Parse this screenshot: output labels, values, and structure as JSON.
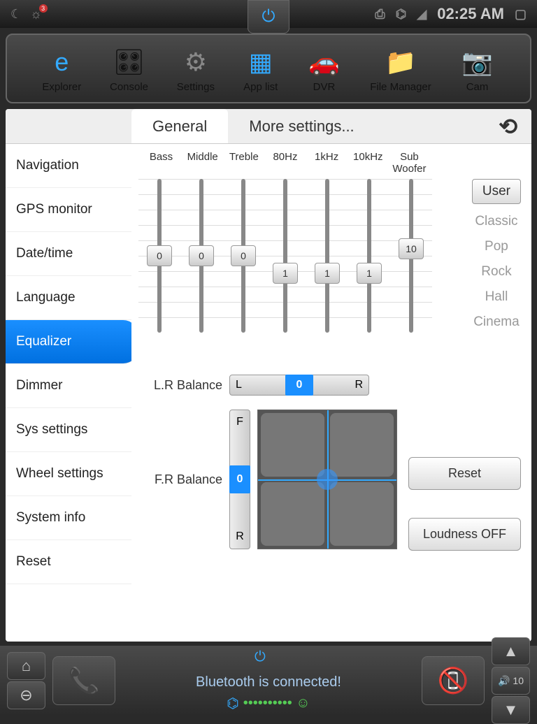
{
  "status": {
    "time": "02:25 AM",
    "badge": "3"
  },
  "dock": [
    {
      "label": "Explorer"
    },
    {
      "label": "Console"
    },
    {
      "label": "Settings"
    },
    {
      "label": "App list"
    },
    {
      "label": "DVR"
    },
    {
      "label": "File Manager"
    },
    {
      "label": "Cam"
    }
  ],
  "tabs": {
    "general": "General",
    "more": "More settings..."
  },
  "sidebar": [
    "Navigation",
    "GPS monitor",
    "Date/time",
    "Language",
    "Equalizer",
    "Dimmer",
    "Sys settings",
    "Wheel settings",
    "System info",
    "Reset"
  ],
  "eq": {
    "bands": [
      "Bass",
      "Middle",
      "Treble",
      "80Hz",
      "1kHz",
      "10kHz",
      "Sub Woofer"
    ],
    "values": [
      "0",
      "0",
      "0",
      "1",
      "1",
      "1",
      "10"
    ],
    "positions": [
      50,
      50,
      50,
      60,
      60,
      60,
      42
    ]
  },
  "presets": [
    "User",
    "Classic",
    "Pop",
    "Rock",
    "Hall",
    "Cinema"
  ],
  "balance": {
    "lr_label": "L.R Balance",
    "lr_l": "L",
    "lr_r": "R",
    "lr_value": "0",
    "fr_label": "F.R Balance",
    "fr_f": "F",
    "fr_r": "R",
    "fr_value": "0"
  },
  "actions": {
    "reset": "Reset",
    "loudness": "Loudness OFF"
  },
  "bottom": {
    "bt_text": "Bluetooth is connected!",
    "volume": "10"
  }
}
